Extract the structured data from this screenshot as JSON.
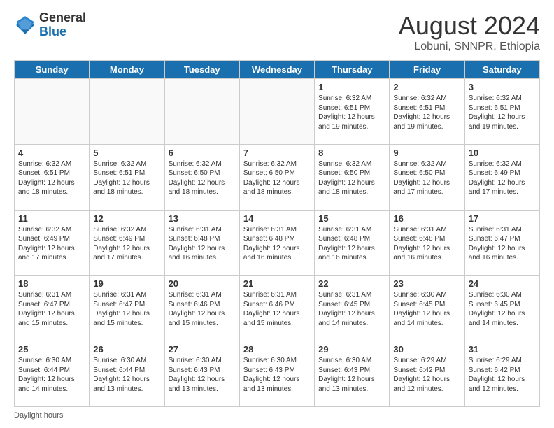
{
  "header": {
    "logo_general": "General",
    "logo_blue": "Blue",
    "title": "August 2024",
    "location": "Lobuni, SNNPR, Ethiopia"
  },
  "days_of_week": [
    "Sunday",
    "Monday",
    "Tuesday",
    "Wednesday",
    "Thursday",
    "Friday",
    "Saturday"
  ],
  "weeks": [
    [
      {
        "day": "",
        "info": ""
      },
      {
        "day": "",
        "info": ""
      },
      {
        "day": "",
        "info": ""
      },
      {
        "day": "",
        "info": ""
      },
      {
        "day": "1",
        "info": "Sunrise: 6:32 AM\nSunset: 6:51 PM\nDaylight: 12 hours and 19 minutes."
      },
      {
        "day": "2",
        "info": "Sunrise: 6:32 AM\nSunset: 6:51 PM\nDaylight: 12 hours and 19 minutes."
      },
      {
        "day": "3",
        "info": "Sunrise: 6:32 AM\nSunset: 6:51 PM\nDaylight: 12 hours and 19 minutes."
      }
    ],
    [
      {
        "day": "4",
        "info": "Sunrise: 6:32 AM\nSunset: 6:51 PM\nDaylight: 12 hours and 18 minutes."
      },
      {
        "day": "5",
        "info": "Sunrise: 6:32 AM\nSunset: 6:51 PM\nDaylight: 12 hours and 18 minutes."
      },
      {
        "day": "6",
        "info": "Sunrise: 6:32 AM\nSunset: 6:50 PM\nDaylight: 12 hours and 18 minutes."
      },
      {
        "day": "7",
        "info": "Sunrise: 6:32 AM\nSunset: 6:50 PM\nDaylight: 12 hours and 18 minutes."
      },
      {
        "day": "8",
        "info": "Sunrise: 6:32 AM\nSunset: 6:50 PM\nDaylight: 12 hours and 18 minutes."
      },
      {
        "day": "9",
        "info": "Sunrise: 6:32 AM\nSunset: 6:50 PM\nDaylight: 12 hours and 17 minutes."
      },
      {
        "day": "10",
        "info": "Sunrise: 6:32 AM\nSunset: 6:49 PM\nDaylight: 12 hours and 17 minutes."
      }
    ],
    [
      {
        "day": "11",
        "info": "Sunrise: 6:32 AM\nSunset: 6:49 PM\nDaylight: 12 hours and 17 minutes."
      },
      {
        "day": "12",
        "info": "Sunrise: 6:32 AM\nSunset: 6:49 PM\nDaylight: 12 hours and 17 minutes."
      },
      {
        "day": "13",
        "info": "Sunrise: 6:31 AM\nSunset: 6:48 PM\nDaylight: 12 hours and 16 minutes."
      },
      {
        "day": "14",
        "info": "Sunrise: 6:31 AM\nSunset: 6:48 PM\nDaylight: 12 hours and 16 minutes."
      },
      {
        "day": "15",
        "info": "Sunrise: 6:31 AM\nSunset: 6:48 PM\nDaylight: 12 hours and 16 minutes."
      },
      {
        "day": "16",
        "info": "Sunrise: 6:31 AM\nSunset: 6:48 PM\nDaylight: 12 hours and 16 minutes."
      },
      {
        "day": "17",
        "info": "Sunrise: 6:31 AM\nSunset: 6:47 PM\nDaylight: 12 hours and 16 minutes."
      }
    ],
    [
      {
        "day": "18",
        "info": "Sunrise: 6:31 AM\nSunset: 6:47 PM\nDaylight: 12 hours and 15 minutes."
      },
      {
        "day": "19",
        "info": "Sunrise: 6:31 AM\nSunset: 6:47 PM\nDaylight: 12 hours and 15 minutes."
      },
      {
        "day": "20",
        "info": "Sunrise: 6:31 AM\nSunset: 6:46 PM\nDaylight: 12 hours and 15 minutes."
      },
      {
        "day": "21",
        "info": "Sunrise: 6:31 AM\nSunset: 6:46 PM\nDaylight: 12 hours and 15 minutes."
      },
      {
        "day": "22",
        "info": "Sunrise: 6:31 AM\nSunset: 6:45 PM\nDaylight: 12 hours and 14 minutes."
      },
      {
        "day": "23",
        "info": "Sunrise: 6:30 AM\nSunset: 6:45 PM\nDaylight: 12 hours and 14 minutes."
      },
      {
        "day": "24",
        "info": "Sunrise: 6:30 AM\nSunset: 6:45 PM\nDaylight: 12 hours and 14 minutes."
      }
    ],
    [
      {
        "day": "25",
        "info": "Sunrise: 6:30 AM\nSunset: 6:44 PM\nDaylight: 12 hours and 14 minutes."
      },
      {
        "day": "26",
        "info": "Sunrise: 6:30 AM\nSunset: 6:44 PM\nDaylight: 12 hours and 13 minutes."
      },
      {
        "day": "27",
        "info": "Sunrise: 6:30 AM\nSunset: 6:43 PM\nDaylight: 12 hours and 13 minutes."
      },
      {
        "day": "28",
        "info": "Sunrise: 6:30 AM\nSunset: 6:43 PM\nDaylight: 12 hours and 13 minutes."
      },
      {
        "day": "29",
        "info": "Sunrise: 6:30 AM\nSunset: 6:43 PM\nDaylight: 12 hours and 13 minutes."
      },
      {
        "day": "30",
        "info": "Sunrise: 6:29 AM\nSunset: 6:42 PM\nDaylight: 12 hours and 12 minutes."
      },
      {
        "day": "31",
        "info": "Sunrise: 6:29 AM\nSunset: 6:42 PM\nDaylight: 12 hours and 12 minutes."
      }
    ]
  ],
  "footer": {
    "daylight_label": "Daylight hours"
  }
}
